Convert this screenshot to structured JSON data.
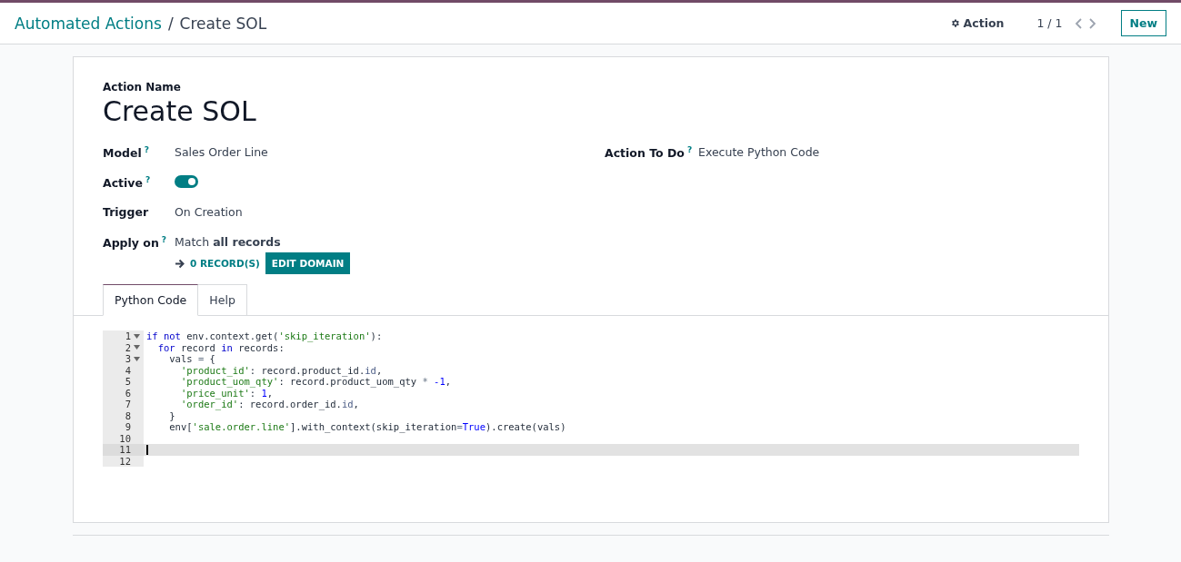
{
  "breadcrumb": {
    "parent": "Automated Actions",
    "separator": "/",
    "current": "Create SOL"
  },
  "control_panel": {
    "action": "Action",
    "pager": "1 / 1",
    "new_button": "New"
  },
  "form": {
    "name_label": "Action Name",
    "name": "Create SOL",
    "left_fields": [
      {
        "kind": "text",
        "label": "Model",
        "help": "?",
        "value": "Sales Order Line"
      },
      {
        "kind": "toggle",
        "label": "Active",
        "help": "?",
        "on": true
      },
      {
        "kind": "text",
        "label": "Trigger",
        "value": "On Creation"
      },
      {
        "kind": "domain",
        "label": "Apply on",
        "help": "?",
        "value": "Match **all records**",
        "records": "0 RECORD(S)",
        "edit": "EDIT DOMAIN"
      }
    ],
    "right_fields": [
      {
        "kind": "text",
        "label": "Action To Do",
        "help": "?",
        "value": "Execute Python Code"
      }
    ],
    "tabs": [
      {
        "label": "Python Code",
        "selected": true
      },
      {
        "label": "Help",
        "selected": false
      }
    ],
    "code_lines": [
      {
        "number": "1",
        "fold": true,
        "active": false,
        "tokens": [
          {
            "kind": "keyword",
            "text": "if not"
          },
          {
            "kind": "plain",
            "text": " env.context.get("
          },
          {
            "kind": "string",
            "text": "'skip_iteration'"
          },
          {
            "kind": "plain",
            "text": "):"
          }
        ]
      },
      {
        "number": "2",
        "fold": true,
        "active": false,
        "tokens": [
          {
            "kind": "keyword",
            "text": "  for"
          },
          {
            "kind": "plain",
            "text": " record "
          },
          {
            "kind": "keyword",
            "text": "in"
          },
          {
            "kind": "plain",
            "text": " records:"
          }
        ]
      },
      {
        "number": "3",
        "fold": true,
        "active": false,
        "tokens": [
          {
            "kind": "plain",
            "text": "    vals "
          },
          {
            "kind": "operator",
            "text": "="
          },
          {
            "kind": "plain",
            "text": " {"
          }
        ]
      },
      {
        "number": "4",
        "fold": false,
        "active": false,
        "tokens": [
          {
            "kind": "string",
            "text": "      'product_id'"
          },
          {
            "kind": "plain",
            "text": ": record.product_id."
          },
          {
            "kind": "attr",
            "text": "id"
          },
          {
            "kind": "plain",
            "text": ","
          }
        ]
      },
      {
        "number": "5",
        "fold": false,
        "active": false,
        "tokens": [
          {
            "kind": "string",
            "text": "      'product_uom_qty'"
          },
          {
            "kind": "plain",
            "text": ": record.product_uom_qty "
          },
          {
            "kind": "operator",
            "text": "*"
          },
          {
            "kind": "number",
            "text": " -1"
          },
          {
            "kind": "plain",
            "text": ","
          }
        ]
      },
      {
        "number": "6",
        "fold": false,
        "active": false,
        "tokens": [
          {
            "kind": "string",
            "text": "      'price_unit'"
          },
          {
            "kind": "plain",
            "text": ": "
          },
          {
            "kind": "number",
            "text": "1"
          },
          {
            "kind": "plain",
            "text": ","
          }
        ]
      },
      {
        "number": "7",
        "fold": false,
        "active": false,
        "tokens": [
          {
            "kind": "string",
            "text": "      'order_id'"
          },
          {
            "kind": "plain",
            "text": ": record.order_id."
          },
          {
            "kind": "attr",
            "text": "id"
          },
          {
            "kind": "plain",
            "text": ","
          }
        ]
      },
      {
        "number": "8",
        "fold": false,
        "active": false,
        "tokens": [
          {
            "kind": "plain",
            "text": "    }"
          }
        ]
      },
      {
        "number": "9",
        "fold": false,
        "active": false,
        "tokens": [
          {
            "kind": "plain",
            "text": "    env["
          },
          {
            "kind": "string",
            "text": "'sale.order.line'"
          },
          {
            "kind": "plain",
            "text": "].with_context(skip_iteration"
          },
          {
            "kind": "operator",
            "text": "="
          },
          {
            "kind": "number",
            "text": "True"
          },
          {
            "kind": "plain",
            "text": ").create(vals)"
          }
        ]
      },
      {
        "number": "10",
        "fold": false,
        "active": false
      },
      {
        "number": "11",
        "fold": false,
        "active": true
      },
      {
        "number": "12",
        "fold": false,
        "active": false
      }
    ]
  }
}
